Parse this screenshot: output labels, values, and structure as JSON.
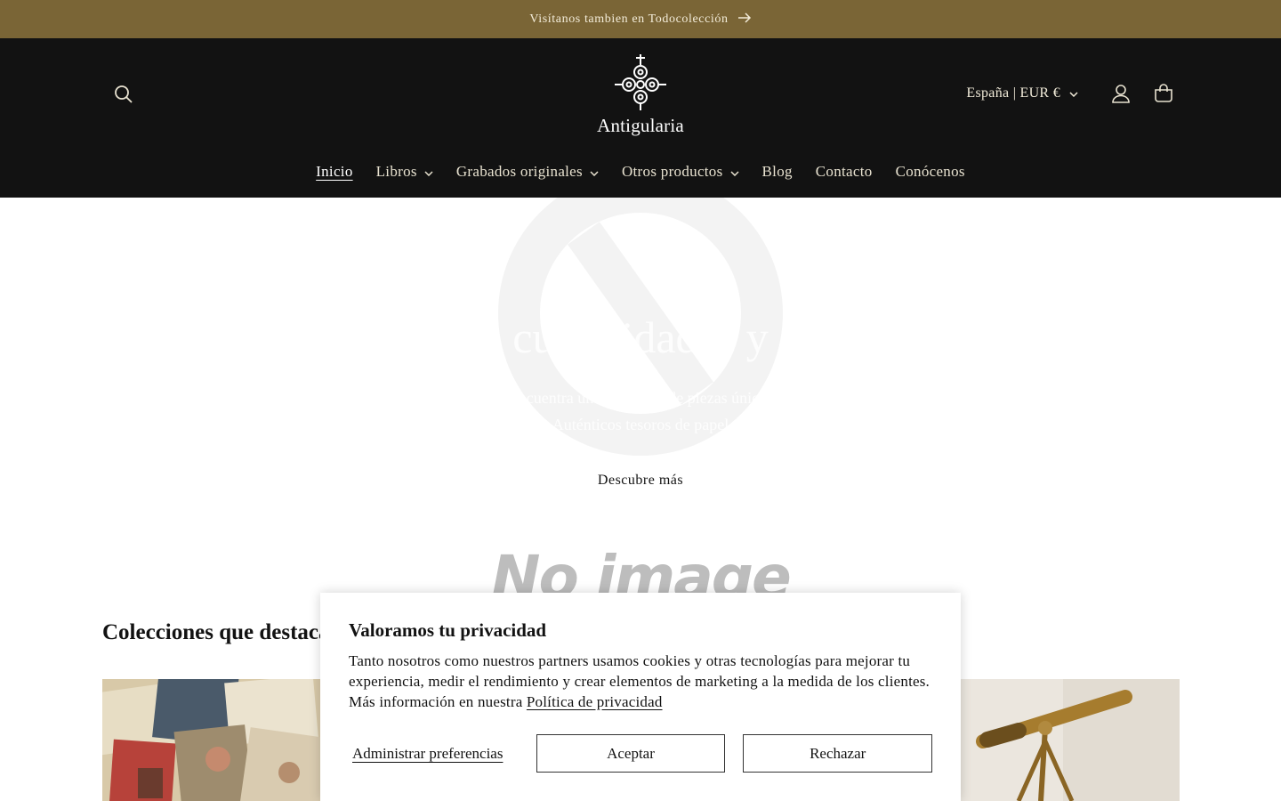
{
  "announcement": {
    "text": "Visítanos tambien en Todocolección",
    "icon": "arrow-right-icon"
  },
  "header": {
    "logo_text": "Antigularia",
    "country_selector": "España | EUR €",
    "icons": [
      "search-icon",
      "user-icon",
      "cart-icon"
    ]
  },
  "nav": {
    "items": [
      {
        "label": "Inicio",
        "active": true,
        "dropdown": false
      },
      {
        "label": "Libros",
        "active": false,
        "dropdown": true
      },
      {
        "label": "Grabados originales",
        "active": false,
        "dropdown": true
      },
      {
        "label": "Otros productos",
        "active": false,
        "dropdown": true
      },
      {
        "label": "Blog",
        "active": false,
        "dropdown": false
      },
      {
        "label": "Contacto",
        "active": false,
        "dropdown": false
      },
      {
        "label": "Conócenos",
        "active": false,
        "dropdown": false
      }
    ]
  },
  "hero": {
    "title": "Antigularia: curiosidades y documentos",
    "subtitle_line1": "Encuentra una selección de piezas únicas",
    "subtitle_line2": "Auténticos tesoros de papel",
    "button": "Descubre más"
  },
  "no_image_text": "No image",
  "collections": {
    "title": "Colecciones que destacamos"
  },
  "cookie_banner": {
    "title": "Valoramos tu privacidad",
    "text": "Tanto nosotros como nuestros partners usamos cookies y otras tecnologías para mejorar tu experiencia, medir el rendimiento y crear elementos de marketing a la medida de los clientes. Más información en nuestra",
    "link": "Política de privacidad",
    "manage": "Administrar preferencias",
    "accept": "Aceptar",
    "reject": "Rechazar"
  },
  "colors": {
    "announcement_bg": "#7a6536",
    "header_bg": "#121212",
    "text_dark": "#121212"
  }
}
